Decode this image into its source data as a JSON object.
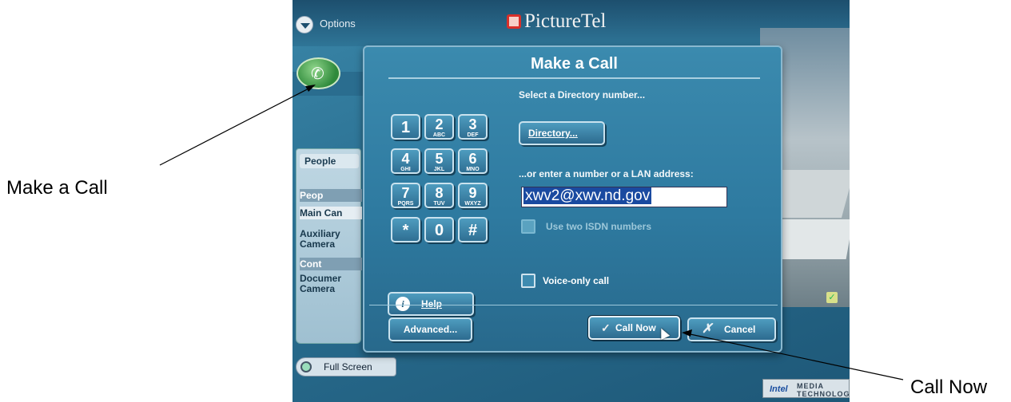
{
  "annotations": {
    "make_call": "Make a Call",
    "call_now": "Call Now"
  },
  "app": {
    "options_label": "Options",
    "logo_text": "PictureTel",
    "full_screen_label": "Full Screen",
    "intel_badge_brand": "Intel",
    "intel_badge_text": "MEDIA TECHNOLOGY"
  },
  "side_panel": {
    "tab_label": "People",
    "rows": [
      {
        "label": "Peop",
        "kind": "header"
      },
      {
        "label": "Main Can",
        "kind": "selected"
      },
      {
        "label": "Auxiliary Camera",
        "kind": "normal"
      },
      {
        "label": "Cont",
        "kind": "header"
      },
      {
        "label": "Documer Camera",
        "kind": "normal"
      }
    ]
  },
  "dialog": {
    "title": "Make a Call",
    "subtitle": "Select a Directory number...",
    "directory_button": "Directory...",
    "enter_label": "...or enter a number or a LAN address:",
    "address_value": "xwv2@xwv.nd.gov",
    "isdn_checkbox_label": "Use two ISDN numbers",
    "voice_only_label": "Voice-only call",
    "help_button": "Help",
    "advanced_button": "Advanced...",
    "call_now_button": "Call Now",
    "cancel_button": "Cancel",
    "keypad": [
      {
        "digit": "1",
        "letters": ""
      },
      {
        "digit": "2",
        "letters": "ABC"
      },
      {
        "digit": "3",
        "letters": "DEF"
      },
      {
        "digit": "4",
        "letters": "GHI"
      },
      {
        "digit": "5",
        "letters": "JKL"
      },
      {
        "digit": "6",
        "letters": "MNO"
      },
      {
        "digit": "7",
        "letters": "PQRS"
      },
      {
        "digit": "8",
        "letters": "TUV"
      },
      {
        "digit": "9",
        "letters": "WXYZ"
      },
      {
        "digit": "*",
        "letters": ""
      },
      {
        "digit": "0",
        "letters": ""
      },
      {
        "digit": "#",
        "letters": ""
      }
    ]
  }
}
